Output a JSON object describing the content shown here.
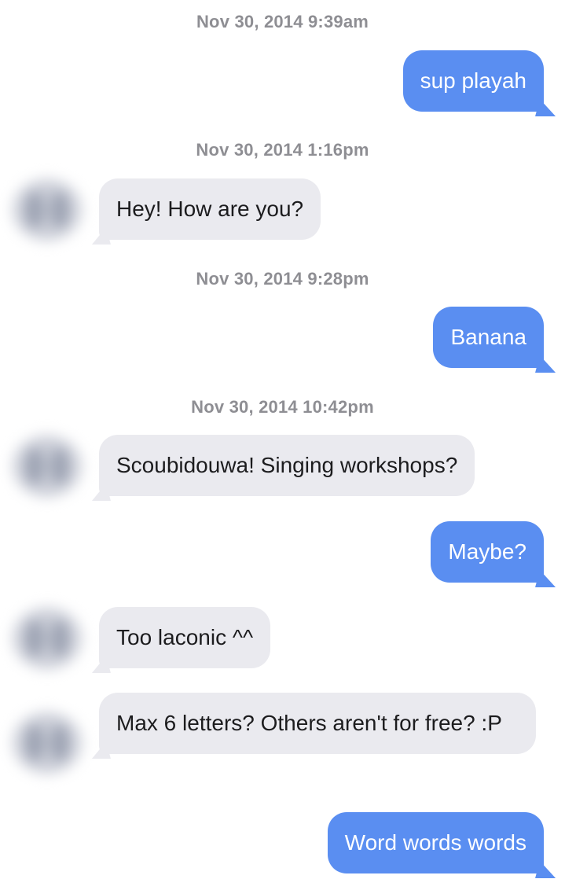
{
  "messages": [
    {
      "type": "timestamp",
      "text": "Nov 30, 2014 9:39am"
    },
    {
      "type": "sent",
      "text": "sup playah"
    },
    {
      "type": "timestamp",
      "text": "Nov 30, 2014 1:16pm"
    },
    {
      "type": "received",
      "text": "Hey! How are you?"
    },
    {
      "type": "timestamp",
      "text": "Nov 30, 2014 9:28pm"
    },
    {
      "type": "sent",
      "text": "Banana"
    },
    {
      "type": "timestamp",
      "text": "Nov 30, 2014 10:42pm"
    },
    {
      "type": "received",
      "text": "Scoubidouwa! Singing workshops?"
    },
    {
      "type": "sent",
      "text": "Maybe?"
    },
    {
      "type": "received",
      "text": "Too laconic ^^"
    },
    {
      "type": "received",
      "text": "Max 6 letters? Others aren't for free? :P"
    },
    {
      "type": "sent",
      "text": "Word words words"
    }
  ],
  "colors": {
    "sent_bubble": "#5a8ef1",
    "received_bubble": "#eaeaef",
    "timestamp": "#8e8e93"
  }
}
